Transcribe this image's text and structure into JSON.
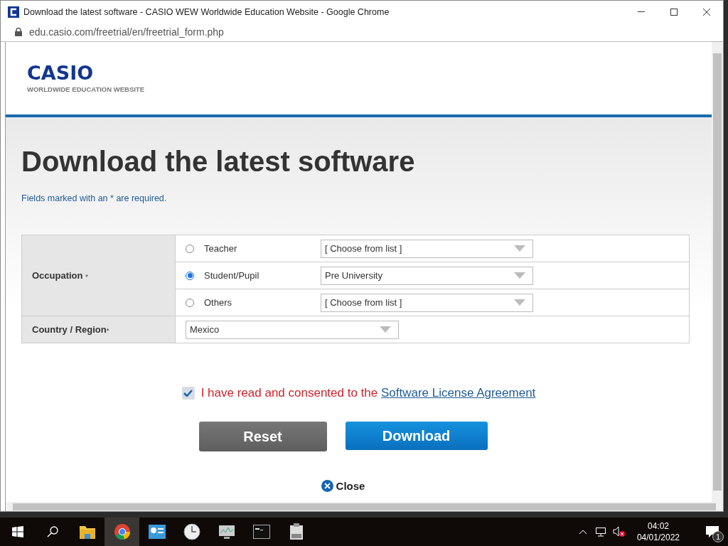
{
  "window": {
    "title": "Download the latest software - CASIO WEW Worldwide Education Website - Google Chrome",
    "url": "edu.casio.com/freetrial/en/freetrial_form.php"
  },
  "header": {
    "logo": "CASIO",
    "logo_subtitle": "WORLDWIDE EDUCATION WEBSITE"
  },
  "heading": "Download the latest software",
  "note": "Fields marked with an * are required.",
  "occupation": {
    "label": "Occupation",
    "mark": "*",
    "options": [
      {
        "label": "Teacher",
        "selected": false,
        "choice": "[ Choose from list ]"
      },
      {
        "label": "Student/Pupil",
        "selected": true,
        "choice": "Pre University"
      },
      {
        "label": "Others",
        "selected": false,
        "choice": "[ Choose from list ]"
      }
    ]
  },
  "country": {
    "label": "Country / Region",
    "mark": "*",
    "value": "Mexico"
  },
  "consent": {
    "checked": true,
    "text": "I have read and consented to the",
    "link": "Software License Agreement"
  },
  "buttons": {
    "reset": "Reset",
    "download": "Download",
    "close": "Close"
  },
  "taskbar": {
    "apps": [
      {
        "kind": "explorer",
        "active": false
      },
      {
        "kind": "chrome",
        "active": true
      },
      {
        "kind": "control",
        "active": false
      },
      {
        "kind": "clock",
        "active": false
      },
      {
        "kind": "monitor",
        "active": false
      },
      {
        "kind": "terminal",
        "active": false
      },
      {
        "kind": "clipboard",
        "active": false
      }
    ],
    "time": "04:02",
    "date": "04/01/2022",
    "notifications": "1"
  }
}
